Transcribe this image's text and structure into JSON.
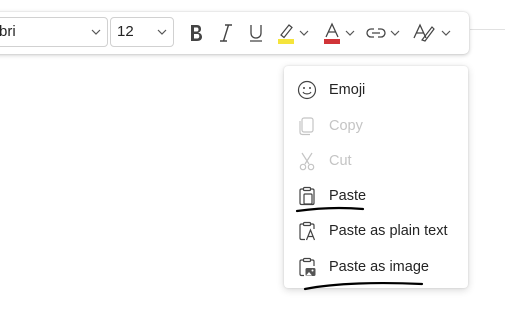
{
  "toolbar": {
    "font_name": "bri",
    "font_size": "12",
    "bold_icon": "bold-icon",
    "italic_icon": "italic-icon",
    "underline_icon": "underline-icon",
    "highlight_icon": "highlighter-icon",
    "font_color_icon": "font-color-icon",
    "link_icon": "link-icon",
    "format_painter_icon": "text-style-icon",
    "highlight_color": "#f5e43b",
    "font_color": "#d13438"
  },
  "context_menu": {
    "items": [
      {
        "label": "Emoji",
        "icon": "emoji-icon",
        "enabled": true
      },
      {
        "label": "Copy",
        "icon": "copy-icon",
        "enabled": false
      },
      {
        "label": "Cut",
        "icon": "cut-icon",
        "enabled": false
      },
      {
        "label": "Paste",
        "icon": "paste-icon",
        "enabled": true
      },
      {
        "label": "Paste as plain text",
        "icon": "paste-plain-text-icon",
        "enabled": true
      },
      {
        "label": "Paste as image",
        "icon": "paste-image-icon",
        "enabled": true
      }
    ]
  },
  "colors": {
    "menu_text": "#242424",
    "disabled_text": "#c4c4c4",
    "annotation_ink": "#000000"
  }
}
